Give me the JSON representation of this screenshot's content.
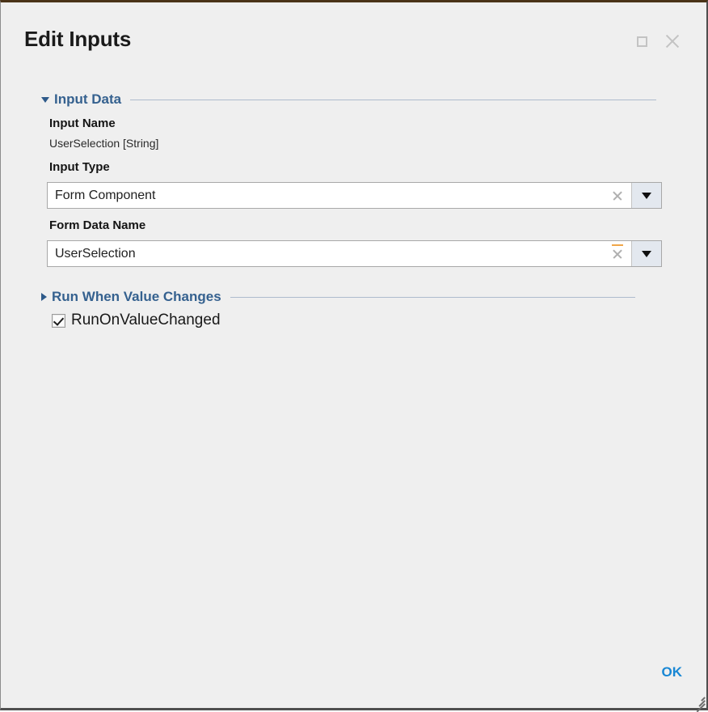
{
  "window": {
    "title": "Edit Inputs",
    "maximize_icon": "maximize-icon",
    "close_icon": "close-icon",
    "accent_color": "#35618f",
    "ok_color": "#1887d4",
    "background_color": "#efefef",
    "top_border_color": "#4a3318"
  },
  "groups": {
    "input_data": {
      "label": "Input Data",
      "expanded": true,
      "twisty_icon": "chevron-down-icon"
    },
    "run_when_value_changes": {
      "label": "Run When Value Changes",
      "expanded": false,
      "twisty_icon": "chevron-right-icon"
    }
  },
  "fields": {
    "input_name": {
      "label": "Input Name",
      "value": "UserSelection [String]"
    },
    "input_type": {
      "label": "Input Type",
      "value": "Form Component",
      "placeholder": "Form Component",
      "clear_icon": "clear-icon",
      "dropdown_icon": "chevron-down-icon"
    },
    "form_data_name": {
      "label": "Form Data Name",
      "value": "UserSelection",
      "placeholder": "UserSelection",
      "clear_icon": "clear-icon",
      "dropdown_icon": "chevron-down-icon",
      "modified_indicator_color": "#f0a64a"
    }
  },
  "checkbox": {
    "label": "RunOnValueChanged",
    "checked": true
  },
  "footer": {
    "ok_label": "OK",
    "resize_grip_icon": "resize-grip-icon"
  }
}
